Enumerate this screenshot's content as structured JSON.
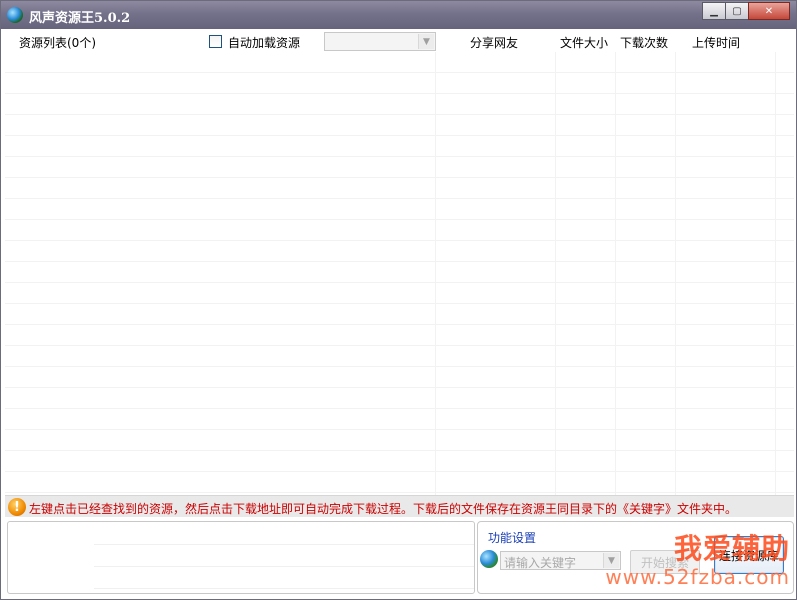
{
  "window": {
    "title": "风声资源王5.0.2",
    "controls": {
      "minimize": "▁",
      "maximize": "▢",
      "close": "✕"
    }
  },
  "header": {
    "resource_list": "资源列表(0个)",
    "auto_load": "自动加载资源",
    "auto_load_checked": false,
    "source_select_value": "",
    "columns": [
      "分享网友",
      "文件大小",
      "下载次数",
      "上传时间"
    ]
  },
  "results": {
    "rows": []
  },
  "info_bar": {
    "icon": "warning-icon",
    "message": "左键点击已经查找到的资源，然后点击下载地址即可自动完成下载过程。下载后的文件保存在资源王同目录下的《关键字》文件夹中。",
    "message_color": "#cc0000"
  },
  "function_settings": {
    "label": "功能设置",
    "keyword_placeholder": "请输入关键字",
    "search_button": "开始搜索",
    "connect_button": "连接资源库"
  },
  "watermark": {
    "text": "我爱辅助",
    "url": "www.52fzba.com"
  }
}
